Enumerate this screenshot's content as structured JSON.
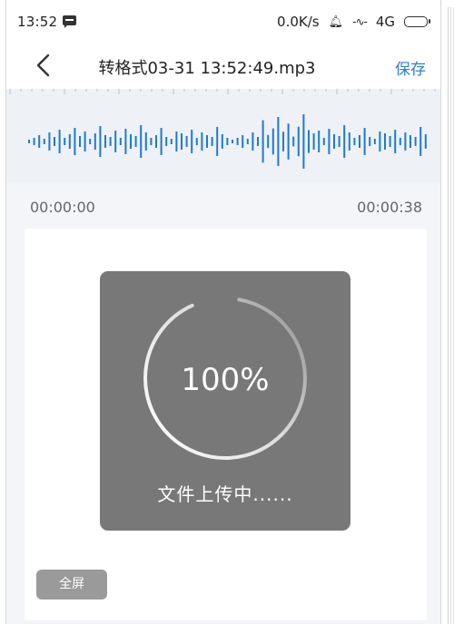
{
  "status_bar": {
    "time": "13:52",
    "net_speed": "0.0K/s",
    "network": "4G",
    "icons": [
      "message-icon",
      "alarm-icon",
      "vibrate-icon",
      "signal-icon",
      "battery-icon"
    ]
  },
  "header": {
    "title": "转格式03-31 13:52:49.mp3",
    "save_label": "保存",
    "back_icon": "chevron-left-icon",
    "accent_color": "#2c7ec9"
  },
  "timeline": {
    "start_time": "00:00:00",
    "end_time": "00:00:38",
    "wave_color": "#1f7acf"
  },
  "upload_dialog": {
    "progress_percent": 100,
    "progress_label": "100%",
    "status_text": "文件上传中......"
  },
  "controls": {
    "fullscreen_label": "全屏"
  }
}
